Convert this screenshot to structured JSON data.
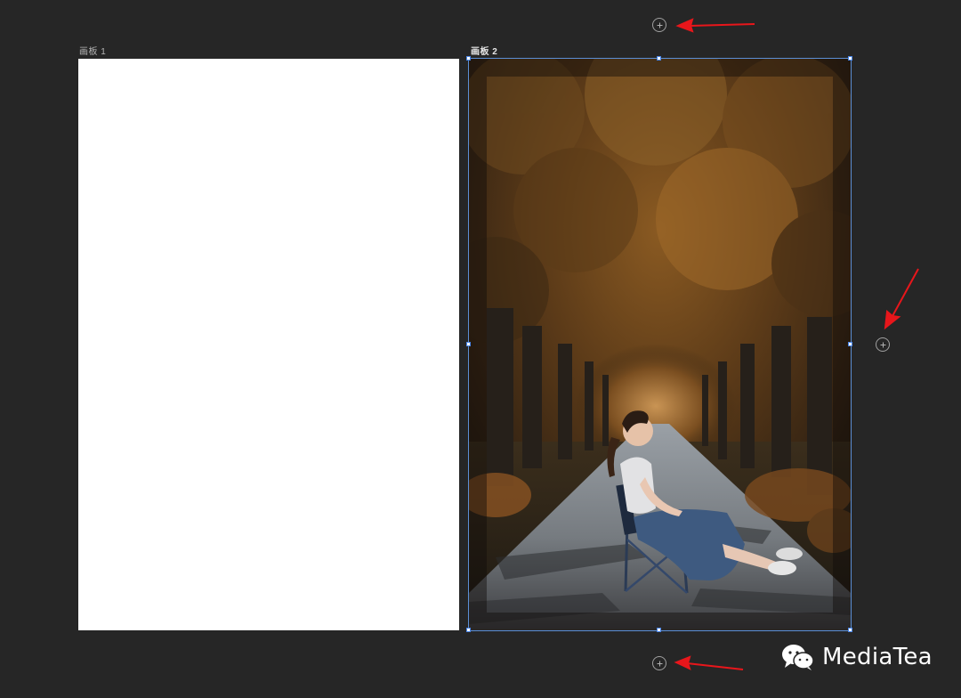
{
  "artboards": [
    {
      "label": "画板 1",
      "selected": false
    },
    {
      "label": "画板 2",
      "selected": true
    }
  ],
  "add_artboard_buttons": [
    "top",
    "right",
    "bottom"
  ],
  "watermark": {
    "text": "MediaTea",
    "icon": "wechat-icon"
  },
  "annotation_color": "#e8161b",
  "selection_color": "#4a86e8",
  "canvas_background": "#262626"
}
